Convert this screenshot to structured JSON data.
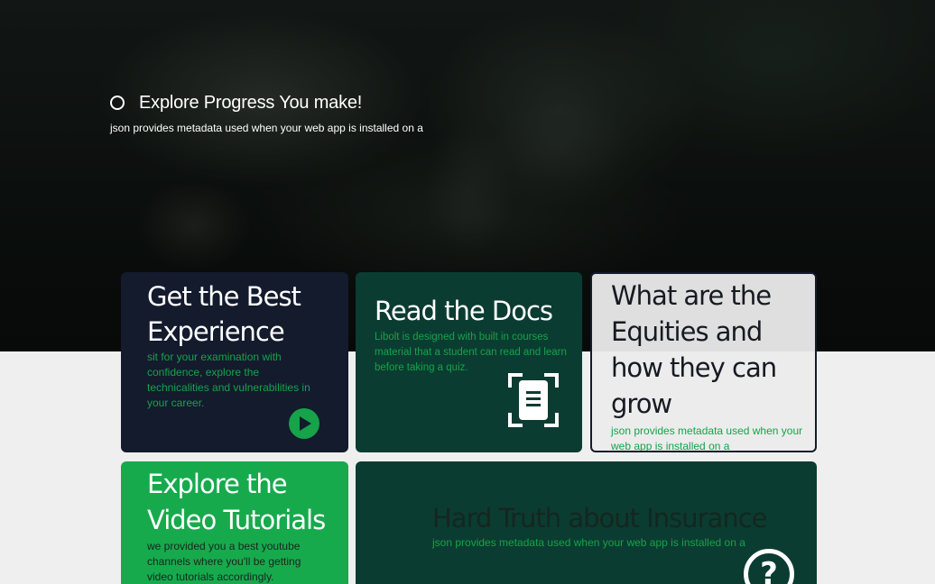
{
  "hero": {
    "title": "Explore Progress You make!",
    "subtitle": "json provides metadata used when your web app is installed on a"
  },
  "cards": [
    {
      "title": "Get the Best Experience",
      "description": "sit for your examination with confidence, explore the technicalities and vulnerabilities in your career.",
      "icon": "play-icon"
    },
    {
      "title": "Read the Docs",
      "description": "Libolt is designed with built in courses material that a student can read and learn before taking a quiz.",
      "icon": "document-scan-icon"
    },
    {
      "title": "What are the Equities and how they can grow",
      "description": "json provides metadata used when your web app is installed on a"
    },
    {
      "title": "Explore the Video Tutorials",
      "description": "we provided you a best youtube channels where you'll be getting video tutorials accordingly."
    },
    {
      "title": "Hard Truth about Insurance",
      "description": "json provides metadata used when your web app is installed on a",
      "icon": "help-icon",
      "icon_text": "?"
    }
  ],
  "colors": {
    "navy": "#131b2d",
    "dark_green": "#0b3c31",
    "accent_green": "#16a34a",
    "bright_green": "#17aa4d",
    "light_gray": "#efefef"
  }
}
